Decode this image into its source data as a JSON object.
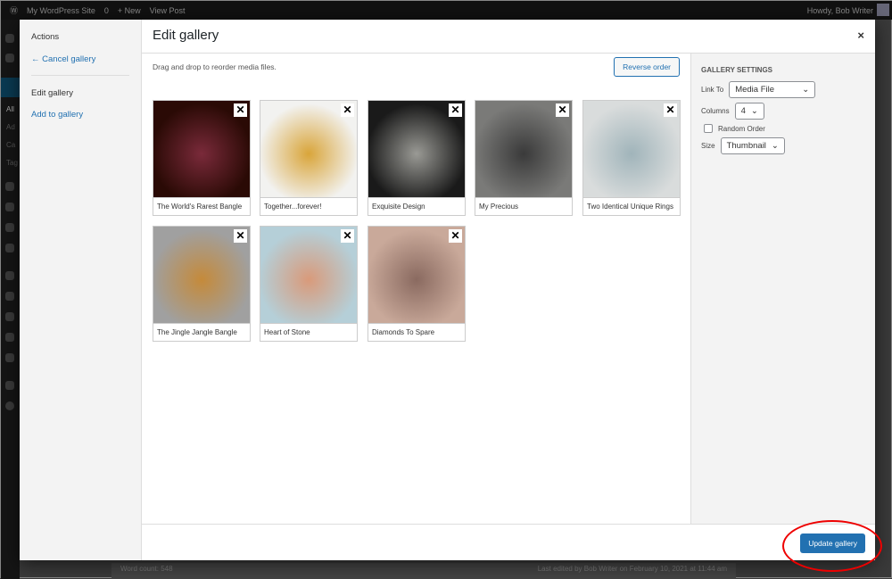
{
  "adminbar": {
    "site": "My WordPress Site",
    "comments": "0",
    "new": "+ New",
    "view": "View Post",
    "howdy": "Howdy, Bob Writer"
  },
  "sidebar_sub": [
    "All",
    "Ad",
    "Ca",
    "Tag"
  ],
  "menu": {
    "actions": "Actions",
    "cancel": "← Cancel gallery",
    "edit": "Edit gallery",
    "add": "Add to gallery"
  },
  "modal": {
    "title": "Edit gallery",
    "close": "×",
    "hint": "Drag and drop to reorder media files.",
    "reverse": "Reverse order",
    "update": "Update gallery"
  },
  "images": [
    {
      "caption": "The World's Rarest Bangle",
      "colors": [
        "#2a0a05",
        "#7a2a3a"
      ]
    },
    {
      "caption": "Together...forever!",
      "colors": [
        "#f2f2f0",
        "#d9a53a"
      ]
    },
    {
      "caption": "Exquisite Design",
      "colors": [
        "#1a1a1a",
        "#9a9a95"
      ]
    },
    {
      "caption": "My Precious",
      "colors": [
        "#7a7a78",
        "#3a3a3a"
      ]
    },
    {
      "caption": "Two Identical Unique Rings",
      "colors": [
        "#d9dcdc",
        "#a0b4ba"
      ]
    },
    {
      "caption": "The Jingle Jangle Bangle",
      "colors": [
        "#a0a0a0",
        "#c58a3a"
      ]
    },
    {
      "caption": "Heart of Stone",
      "colors": [
        "#b5cfd8",
        "#d99a7a"
      ]
    },
    {
      "caption": "Diamonds To Spare",
      "colors": [
        "#c9a99a",
        "#8a6a60"
      ]
    }
  ],
  "settings": {
    "heading": "GALLERY SETTINGS",
    "link_label": "Link To",
    "link_value": "Media File",
    "columns_label": "Columns",
    "columns_value": "4",
    "random_label": "Random Order",
    "random_checked": false,
    "size_label": "Size",
    "size_value": "Thumbnail"
  },
  "editor": {
    "wordcount": "Word count: 548",
    "lastedit": "Last edited by Bob Writer on February 10, 2021 at 11:44 am"
  }
}
